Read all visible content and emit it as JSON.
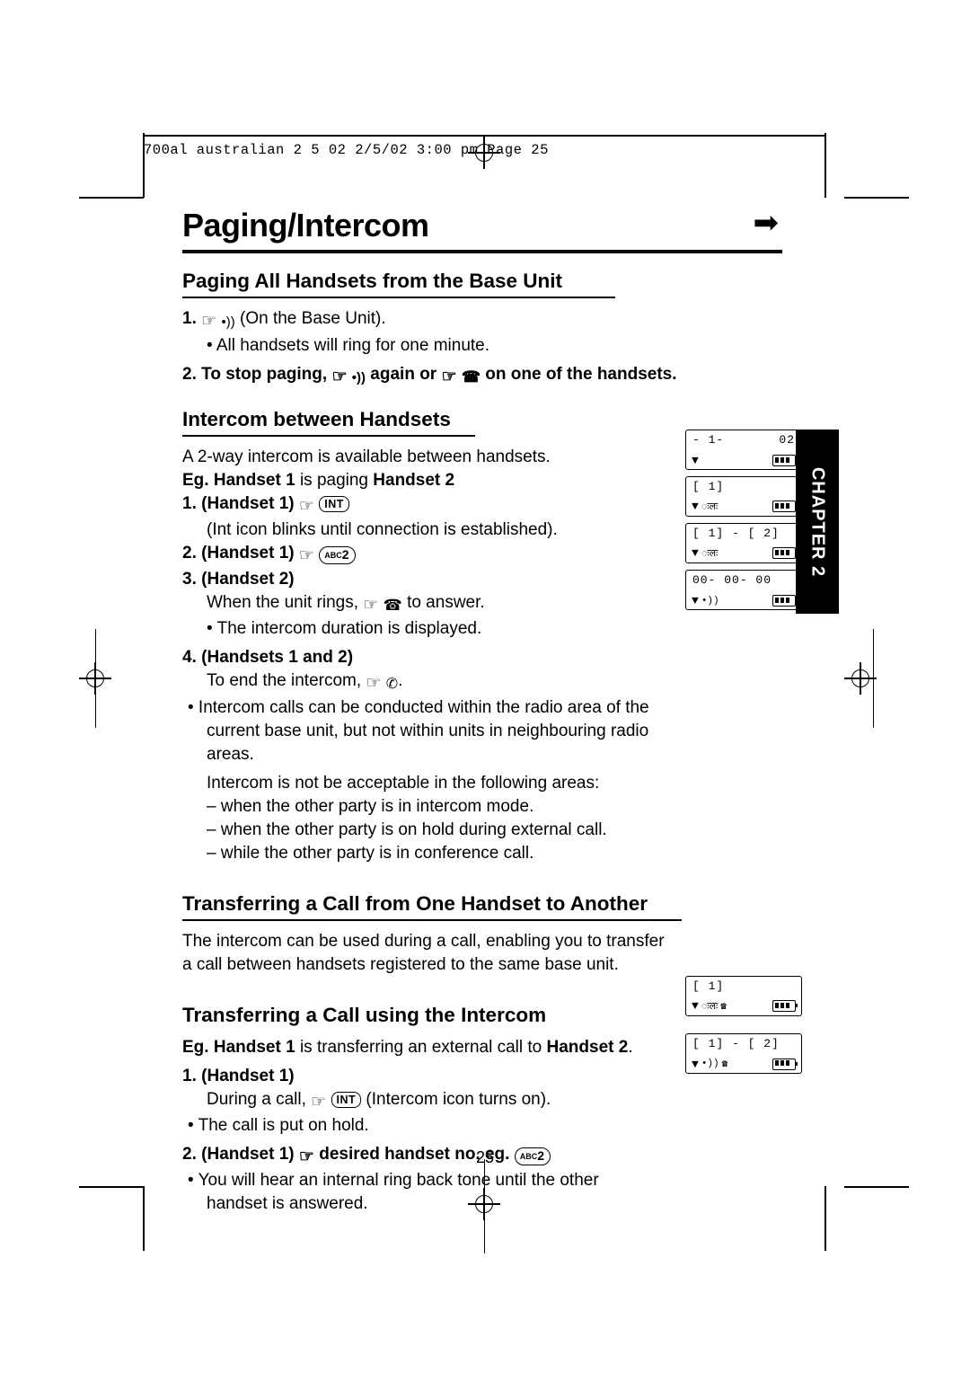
{
  "slug": "700al  australian 2 5 02  2/5/02  3:00 pm  Page 25",
  "title": "Paging/Intercom",
  "arrow_icon": "➡",
  "chapter_tab": "CHAPTER 2",
  "page_number": "25",
  "sections": {
    "paging_all": {
      "heading": "Paging All Handsets from the Base Unit",
      "step1_num": "1.",
      "step1_tail": "(On the Base Unit).",
      "step1_bullet": "• All handsets will ring for one minute.",
      "step2_num": "2.",
      "step2_a": "To stop paging,",
      "step2_b": "again or",
      "step2_c": "on one of the handsets."
    },
    "intercom_between": {
      "heading": "Intercom between Handsets",
      "intro": "A 2-way intercom is available between handsets.",
      "eg_prefix": "Eg.",
      "eg_bold1": "Handset 1",
      "eg_mid": "is paging",
      "eg_bold2": "Handset 2",
      "s1_num": "1.",
      "s1_label": "(Handset 1)",
      "s1_note": "(Int icon blinks until connection is established).",
      "s2_num": "2.",
      "s2_label": "(Handset 1)",
      "s3_num": "3.",
      "s3_label": "(Handset 2)",
      "s3_line": "When the unit rings,",
      "s3_line_tail": "to answer.",
      "s3_bullet": "• The intercom duration is displayed.",
      "s4_num": "4.",
      "s4_label": "(Handsets 1 and 2)",
      "s4_line": "To end the intercom,",
      "s4_line_tail": ".",
      "note_bullet": "• Intercom calls can be conducted within the radio area of the",
      "note_l2": "current base unit, but not within units in neighbouring radio",
      "note_l3": "areas.",
      "areas_intro": "Intercom is not be acceptable in the following areas:",
      "areas": [
        "– when the other party is in intercom mode.",
        "– when the other party is on hold during external call.",
        "– while the other party is in conference call."
      ]
    },
    "transfer": {
      "heading": "Transferring a Call from One Handset to Another",
      "body_l1": "The intercom can be used during a call, enabling you to transfer",
      "body_l2": "a call between handsets registered to the same base unit."
    },
    "transfer_intercom": {
      "heading": "Transferring a Call using the Intercom",
      "eg_prefix": "Eg.",
      "eg_bold1": "Handset 1",
      "eg_mid": "is transferring an external call to",
      "eg_bold2": "Handset 2",
      "eg_end": ".",
      "s1_num": "1.",
      "s1_label": "(Handset 1)",
      "s1_line": "During a call,",
      "s1_line_tail": "(Intercom icon turns on).",
      "s1_bullet": "• The call is put on hold.",
      "s2_num": "2.",
      "s2_label": "(Handset 1)",
      "s2_text": "desired handset no. eg.",
      "s2_bullet": "• You will hear an internal ring back tone until the other",
      "s2_bullet_l2": "handset is answered."
    }
  },
  "keys": {
    "int": "INT",
    "abc_prefix": "ABC",
    "abc_digit": "2"
  },
  "lcd_panels": [
    {
      "top_left": "- 1-",
      "top_right": "02",
      "has_batt": false
    },
    {
      "top_left": "[ 1]",
      "top_right": "",
      "has_batt": true
    },
    {
      "top_left": "[ 1] - [ 2]",
      "top_right": "",
      "has_batt": true
    },
    {
      "top_left": "00- 00- 00",
      "top_right": "",
      "has_batt": true
    },
    {
      "top_left": "[ 1]",
      "top_right": "",
      "has_batt": true
    },
    {
      "top_left": "[ 1] - [ 2]",
      "top_right": "",
      "has_batt": true
    }
  ]
}
